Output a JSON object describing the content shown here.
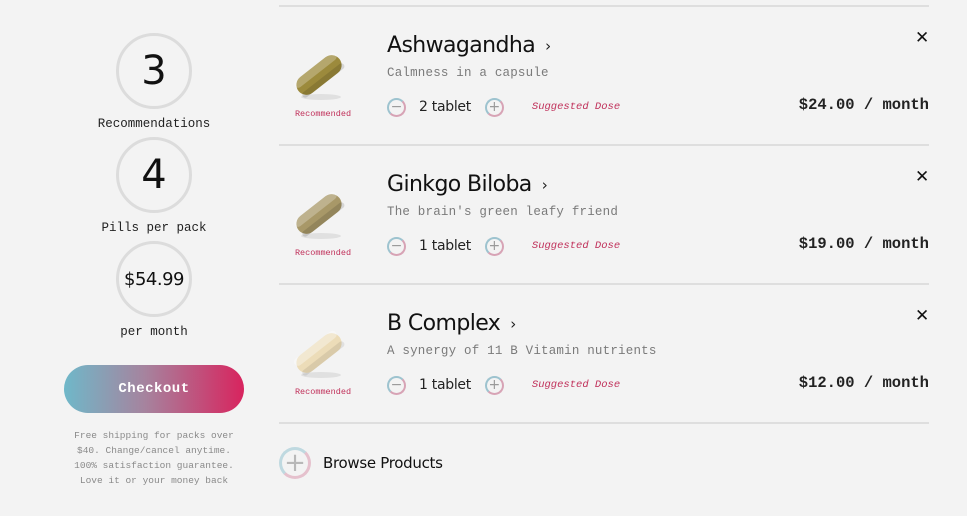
{
  "summary": {
    "recommendations_count": "3",
    "recommendations_label": "Recommendations",
    "pills_count": "4",
    "pills_label": "Pills per pack",
    "monthly_total": "$54.99",
    "monthly_label": "per month",
    "checkout_label": "Checkout",
    "fineprint": [
      "Free shipping for packs over",
      "$40. Change/cancel anytime.",
      "100% satisfaction guarantee.",
      "Love it or your money back"
    ]
  },
  "products": [
    {
      "name": "Ashwagandha",
      "tagline": "Calmness in a capsule",
      "badge": "Recommended",
      "dose": "2 tablet",
      "dose_note": "Suggested Dose",
      "price": "$24.00 / month",
      "pill_color": "#9c8a3c"
    },
    {
      "name": "Ginkgo Biloba",
      "tagline": "The brain's green leafy friend",
      "badge": "Recommended",
      "dose": "1 tablet",
      "dose_note": "Suggested Dose",
      "price": "$19.00 / month",
      "pill_color": "#a89868"
    },
    {
      "name": "B Complex",
      "tagline": "A synergy of 11 B Vitamin nutrients",
      "badge": "Recommended",
      "dose": "1 tablet",
      "dose_note": "Suggested Dose",
      "price": "$12.00 / month",
      "pill_color": "#ecdcb8"
    }
  ],
  "icons": {
    "minus": "minus-icon",
    "plus": "plus-icon",
    "remove": "close-icon",
    "chevron": "chevron-right-icon",
    "browse": "plus-circle-icon"
  },
  "symbols": {
    "minus": "−",
    "plus": "+",
    "remove": "✕",
    "chevron": "›",
    "browse_plus": "+"
  },
  "browse_label": "Browse Products",
  "colors": {
    "accent": "#c0305a",
    "checkout_start": "#6fb8c9",
    "checkout_end": "#d8245e"
  }
}
